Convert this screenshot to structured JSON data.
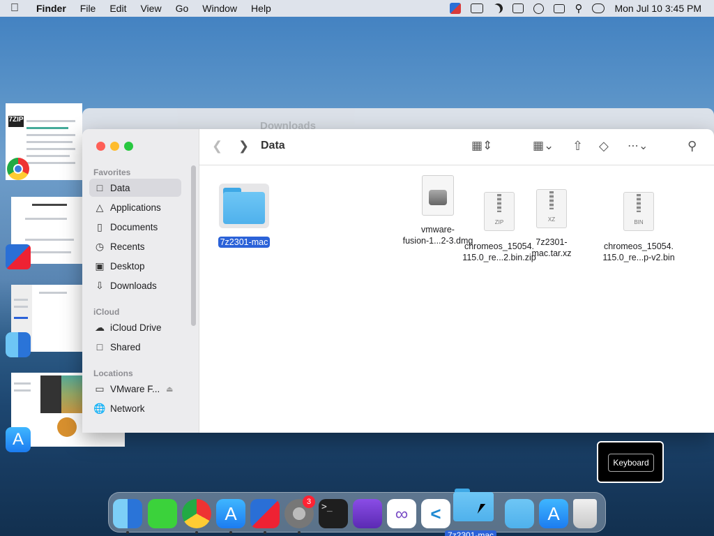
{
  "menubar": {
    "app_name": "Finder",
    "menus": [
      "File",
      "Edit",
      "View",
      "Go",
      "Window",
      "Help"
    ],
    "clock": "Mon Jul 10  3:45 PM"
  },
  "finder": {
    "title": "Data",
    "background_title": "Downloads",
    "sidebar": {
      "favorites_label": "Favorites",
      "favorites": [
        {
          "label": "Data",
          "icon": "folder-icon"
        },
        {
          "label": "Applications",
          "icon": "applications-icon"
        },
        {
          "label": "Documents",
          "icon": "document-icon"
        },
        {
          "label": "Recents",
          "icon": "clock-icon"
        },
        {
          "label": "Desktop",
          "icon": "desktop-icon"
        },
        {
          "label": "Downloads",
          "icon": "download-icon"
        }
      ],
      "icloud_label": "iCloud",
      "icloud": [
        {
          "label": "iCloud Drive",
          "icon": "cloud-icon"
        },
        {
          "label": "Shared",
          "icon": "shared-folder-icon"
        }
      ],
      "locations_label": "Locations",
      "locations": [
        {
          "label": "VMware F...",
          "icon": "drive-icon"
        },
        {
          "label": "Network",
          "icon": "globe-icon"
        }
      ]
    },
    "files": [
      {
        "name": "7z2301-mac",
        "type": "folder",
        "selected": true
      },
      {
        "name_line1": "vmware-",
        "name_line2": "fusion-1...2-3.dmg",
        "type": "dmg",
        "ext": ""
      },
      {
        "name_line1": "chromeos_15054.",
        "name_line2": "115.0_re...2.bin.zip",
        "type": "zip",
        "ext": "ZIP"
      },
      {
        "name_line1": "7z2301-",
        "name_line2": "mac.tar.xz",
        "type": "xz",
        "ext": "XZ"
      },
      {
        "name_line1": "chromeos_15054.",
        "name_line2": "115.0_re...p-v2.bin",
        "type": "bin",
        "ext": "BIN"
      }
    ]
  },
  "keyboard_popup": {
    "label": "Keyboard"
  },
  "dock": {
    "badge": "3",
    "drag_label": "7z2301-mac"
  }
}
